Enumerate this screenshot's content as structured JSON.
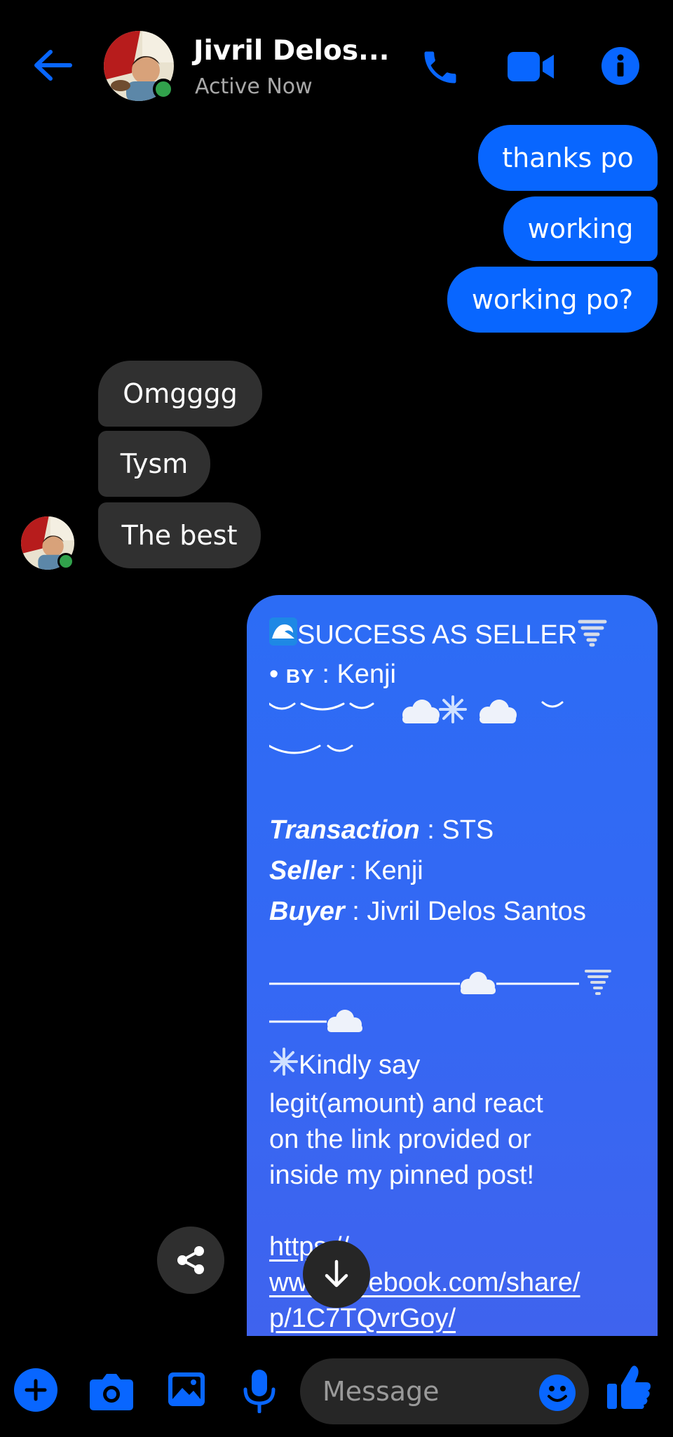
{
  "header": {
    "contact_name": "Jivril Delos...",
    "status": "Active Now",
    "icons": [
      "back-arrow-icon",
      "phone-icon",
      "video-camera-icon",
      "info-icon"
    ]
  },
  "messages_outgoing": [
    "thanks po",
    "working",
    "working po?"
  ],
  "messages_incoming": [
    "Omgggg",
    "Tysm",
    "The best"
  ],
  "card": {
    "title": "SUCCESS AS SELLER",
    "by_label": "BY",
    "by_value": ": Kenji",
    "transaction_label": "Transaction",
    "transaction_value": " : STS",
    "seller_label": "Seller",
    "seller_value": " : Kenji",
    "buyer_label": "Buyer",
    "buyer_value": " : Jivril Delos Santos",
    "instruction_1": "Kindly say",
    "instruction_2": "legit(amount) and react",
    "instruction_3": "on the link provided or",
    "instruction_4": "inside my pinned post!",
    "link_1": "https://",
    "link_2": "www.facebook.com/share/",
    "link_3": "p/1C7TQvrGoy/"
  },
  "composer": {
    "placeholder": "Message"
  },
  "colors": {
    "accent": "#0866ff",
    "incoming_bubble": "#303030",
    "online": "#31a24c"
  }
}
